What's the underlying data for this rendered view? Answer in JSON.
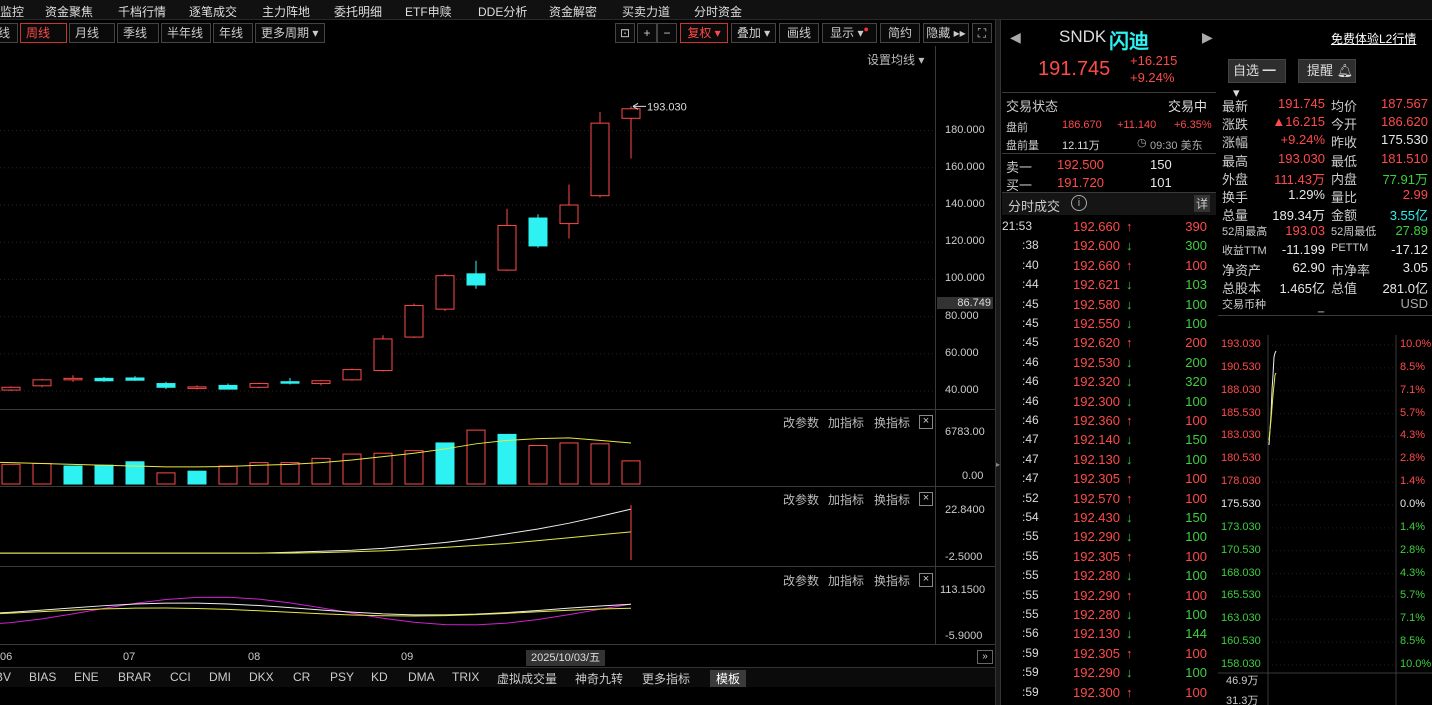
{
  "menu": [
    "监控",
    "资金聚焦",
    "千档行情",
    "逐笔成交",
    "主力阵地",
    "委托明细",
    "ETF申赎",
    "DDE分析",
    "资金解密",
    "买卖力道",
    "分时资金"
  ],
  "periods": [
    "线",
    "周线",
    "月线",
    "季线",
    "半年线",
    "年线",
    "更多周期"
  ],
  "toolbar": {
    "fuquan": "复权",
    "diejia": "叠加",
    "huaxian": "画线",
    "xianshi": "显示",
    "jianyue": "简约",
    "yincang": "隐藏"
  },
  "chart": {
    "set_ma": "设置均线",
    "high_label": "193.030",
    "last_price_label": "86.749",
    "price_ticks": [
      "180.000",
      "160.000",
      "140.000",
      "120.000",
      "100.000",
      "80.000",
      "60.000",
      "40.000"
    ],
    "vol_ticks": [
      "6783.00",
      "0.00"
    ],
    "ind2_ticks": [
      "22.8400",
      "-2.5000"
    ],
    "ind3_ticks": [
      "113.1500",
      "-5.9000"
    ],
    "sub_tools": [
      "改参数",
      "加指标",
      "换指标"
    ],
    "x_labels": [
      "06",
      "07",
      "08",
      "09"
    ],
    "cursor_date": "2025/10/03/五",
    "candles": [
      {
        "o": 38.5,
        "h": 39.5,
        "l": 37.5,
        "c": 39.0
      },
      {
        "o": 40.5,
        "h": 42.5,
        "l": 40.0,
        "c": 42.0
      },
      {
        "o": 42.8,
        "h": 46.5,
        "l": 42.0,
        "c": 46.0
      },
      {
        "o": 46.0,
        "h": 48.5,
        "l": 45.0,
        "c": 46.8
      },
      {
        "o": 46.8,
        "h": 47.5,
        "l": 45.0,
        "c": 45.5
      },
      {
        "o": 47.0,
        "h": 48.0,
        "l": 45.5,
        "c": 45.8
      },
      {
        "o": 44.0,
        "h": 45.0,
        "l": 41.0,
        "c": 42.0
      },
      {
        "o": 41.5,
        "h": 43.0,
        "l": 40.8,
        "c": 42.2
      },
      {
        "o": 43.0,
        "h": 44.0,
        "l": 40.8,
        "c": 41.0
      },
      {
        "o": 42.0,
        "h": 44.5,
        "l": 41.5,
        "c": 44.0
      },
      {
        "o": 45.0,
        "h": 47.0,
        "l": 43.5,
        "c": 44.5
      },
      {
        "o": 44.0,
        "h": 46.0,
        "l": 43.0,
        "c": 45.5
      },
      {
        "o": 46.0,
        "h": 52.0,
        "l": 45.5,
        "c": 51.5
      },
      {
        "o": 51.0,
        "h": 70.0,
        "l": 50.5,
        "c": 68.0
      },
      {
        "o": 69.0,
        "h": 87.0,
        "l": 68.5,
        "c": 86.0
      },
      {
        "o": 84.0,
        "h": 103.0,
        "l": 83.0,
        "c": 102.0
      },
      {
        "o": 103.0,
        "h": 110.0,
        "l": 95.0,
        "c": 97.0
      },
      {
        "o": 105.0,
        "h": 138.0,
        "l": 104.5,
        "c": 129.0
      },
      {
        "o": 133.0,
        "h": 135.0,
        "l": 117.0,
        "c": 118.0
      },
      {
        "o": 130.0,
        "h": 151.0,
        "l": 122.0,
        "c": 140.0
      },
      {
        "o": 145.0,
        "h": 190.0,
        "l": 144.0,
        "c": 184.0
      },
      {
        "o": 186.62,
        "h": 193.03,
        "l": 165.0,
        "c": 191.745
      }
    ],
    "volumes": [
      2400,
      3000,
      2300,
      2400,
      2100,
      2200,
      2600,
      1300,
      1500,
      2100,
      2500,
      2500,
      3000,
      3500,
      3600,
      3900,
      4800,
      6300,
      5800,
      4500,
      4800,
      4700,
      2700
    ],
    "vol_up": [
      true,
      true,
      true,
      true,
      false,
      false,
      false,
      true,
      false,
      true,
      true,
      true,
      true,
      true,
      true,
      true,
      false,
      true,
      false,
      true,
      true,
      true,
      true
    ],
    "vol_ma": [
      2600,
      2600,
      2500,
      2400,
      2300,
      2200,
      2100,
      2000,
      2000,
      2050,
      2200,
      2300,
      2500,
      2800,
      3200,
      3600,
      4100,
      4700,
      5100,
      5300,
      5400,
      5100,
      4800
    ]
  },
  "bottom_tabs": [
    "BV",
    "BIAS",
    "ENE",
    "BRAR",
    "CCI",
    "DMI",
    "DKX",
    "CR",
    "PSY",
    "KD",
    "DMA",
    "TRIX",
    "虚拟成交量",
    "神奇九转",
    "更多指标",
    "模板"
  ],
  "stock": {
    "code": "SNDK",
    "name": "闪迪",
    "price": "191.745",
    "change": "+16.215",
    "pct": "+9.24%",
    "l2": "免费体验L2行情",
    "zixuan": "自选",
    "tixing": "提醒"
  },
  "trade_status": {
    "label": "交易状态",
    "value": "交易中",
    "pre_label": "盘前",
    "pre_price": "186.670",
    "pre_change": "+11.140",
    "pre_pct": "+6.35%",
    "pre_vol_label": "盘前量",
    "pre_vol": "12.11万",
    "time": "09:30 美东"
  },
  "book": [
    {
      "side": "卖一",
      "price": "192.500",
      "vol": "150"
    },
    {
      "side": "买一",
      "price": "191.720",
      "vol": "101"
    }
  ],
  "trades_title": "分时成交",
  "trades_detail": "详",
  "trades": [
    {
      "t": "21:53",
      "p": "192.660",
      "d": "up",
      "v": "390"
    },
    {
      "t": ":38",
      "p": "192.600",
      "d": "down",
      "v": "300"
    },
    {
      "t": ":40",
      "p": "192.660",
      "d": "up",
      "v": "100"
    },
    {
      "t": ":44",
      "p": "192.621",
      "d": "down",
      "v": "103"
    },
    {
      "t": ":45",
      "p": "192.580",
      "d": "down",
      "v": "100"
    },
    {
      "t": ":45",
      "p": "192.550",
      "d": "down",
      "v": "100"
    },
    {
      "t": ":45",
      "p": "192.620",
      "d": "up",
      "v": "200"
    },
    {
      "t": ":46",
      "p": "192.530",
      "d": "down",
      "v": "200"
    },
    {
      "t": ":46",
      "p": "192.320",
      "d": "down",
      "v": "320"
    },
    {
      "t": ":46",
      "p": "192.300",
      "d": "down",
      "v": "100"
    },
    {
      "t": ":46",
      "p": "192.360",
      "d": "up",
      "v": "100"
    },
    {
      "t": ":47",
      "p": "192.140",
      "d": "down",
      "v": "150"
    },
    {
      "t": ":47",
      "p": "192.130",
      "d": "down",
      "v": "100"
    },
    {
      "t": ":47",
      "p": "192.305",
      "d": "up",
      "v": "100"
    },
    {
      "t": ":52",
      "p": "192.570",
      "d": "up",
      "v": "100"
    },
    {
      "t": ":54",
      "p": "192.430",
      "d": "down",
      "v": "150"
    },
    {
      "t": ":55",
      "p": "192.290",
      "d": "down",
      "v": "100"
    },
    {
      "t": ":55",
      "p": "192.305",
      "d": "up",
      "v": "100"
    },
    {
      "t": ":55",
      "p": "192.280",
      "d": "down",
      "v": "100"
    },
    {
      "t": ":55",
      "p": "192.290",
      "d": "up",
      "v": "100"
    },
    {
      "t": ":55",
      "p": "192.280",
      "d": "down",
      "v": "100"
    },
    {
      "t": ":56",
      "p": "192.130",
      "d": "down",
      "v": "144"
    },
    {
      "t": ":59",
      "p": "192.305",
      "d": "up",
      "v": "100"
    },
    {
      "t": ":59",
      "p": "192.290",
      "d": "down",
      "v": "100"
    },
    {
      "t": ":59",
      "p": "192.300",
      "d": "up",
      "v": "100"
    }
  ],
  "quote": {
    "rows": [
      {
        "l1": "最新",
        "v1": "191.745",
        "c1": "red",
        "l2": "均价",
        "v2": "187.567",
        "c2": "red"
      },
      {
        "l1": "涨跌",
        "v1": "▲16.215",
        "c1": "red",
        "l2": "今开",
        "v2": "186.620",
        "c2": "red"
      },
      {
        "l1": "涨幅",
        "v1": "+9.24%",
        "c1": "red",
        "l2": "昨收",
        "v2": "175.530",
        "c2": "white"
      },
      {
        "l1": "最高",
        "v1": "193.030",
        "c1": "red",
        "l2": "最低",
        "v2": "181.510",
        "c2": "red"
      },
      {
        "l1": "外盘",
        "v1": "111.43万",
        "c1": "red",
        "l2": "内盘",
        "v2": "77.91万",
        "c2": "green"
      },
      {
        "l1": "换手",
        "v1": "1.29%",
        "c1": "white",
        "l2": "量比",
        "v2": "2.99",
        "c2": "red"
      },
      {
        "l1": "总量",
        "v1": "189.34万",
        "c1": "white",
        "l2": "金额",
        "v2": "3.55亿",
        "c2": "cyan"
      },
      {
        "l1": "52周最高",
        "v1": "193.03",
        "c1": "red",
        "l2": "52周最低",
        "v2": "27.89",
        "c2": "green"
      },
      {
        "l1": "收益TTM",
        "v1": "-11.199",
        "c1": "white",
        "l2": "PETTM",
        "v2": "-17.12",
        "c2": "white"
      },
      {
        "l1": "净资产",
        "v1": "62.90",
        "c1": "white",
        "l2": "市净率",
        "v2": "3.05",
        "c2": "white"
      },
      {
        "l1": "总股本",
        "v1": "1.465亿",
        "c1": "white",
        "l2": "总值",
        "v2": "281.0亿",
        "c2": "white"
      },
      {
        "l1": "交易币种",
        "v1": "",
        "c1": "white",
        "l2": "",
        "v2": "USD",
        "c2": "gray"
      }
    ]
  },
  "intraday": {
    "left": [
      "193.030",
      "190.530",
      "188.030",
      "185.530",
      "183.030",
      "180.530",
      "178.030",
      "175.530",
      "173.030",
      "170.530",
      "168.030",
      "165.530",
      "163.030",
      "160.530",
      "158.030"
    ],
    "right": [
      "10.0%",
      "8.5%",
      "7.1%",
      "5.7%",
      "4.3%",
      "2.8%",
      "1.4%",
      "0.0%",
      "1.4%",
      "2.8%",
      "4.3%",
      "5.7%",
      "7.1%",
      "8.5%",
      "10.0%"
    ],
    "vol_labels": [
      "46.9万",
      "31.3万"
    ]
  }
}
